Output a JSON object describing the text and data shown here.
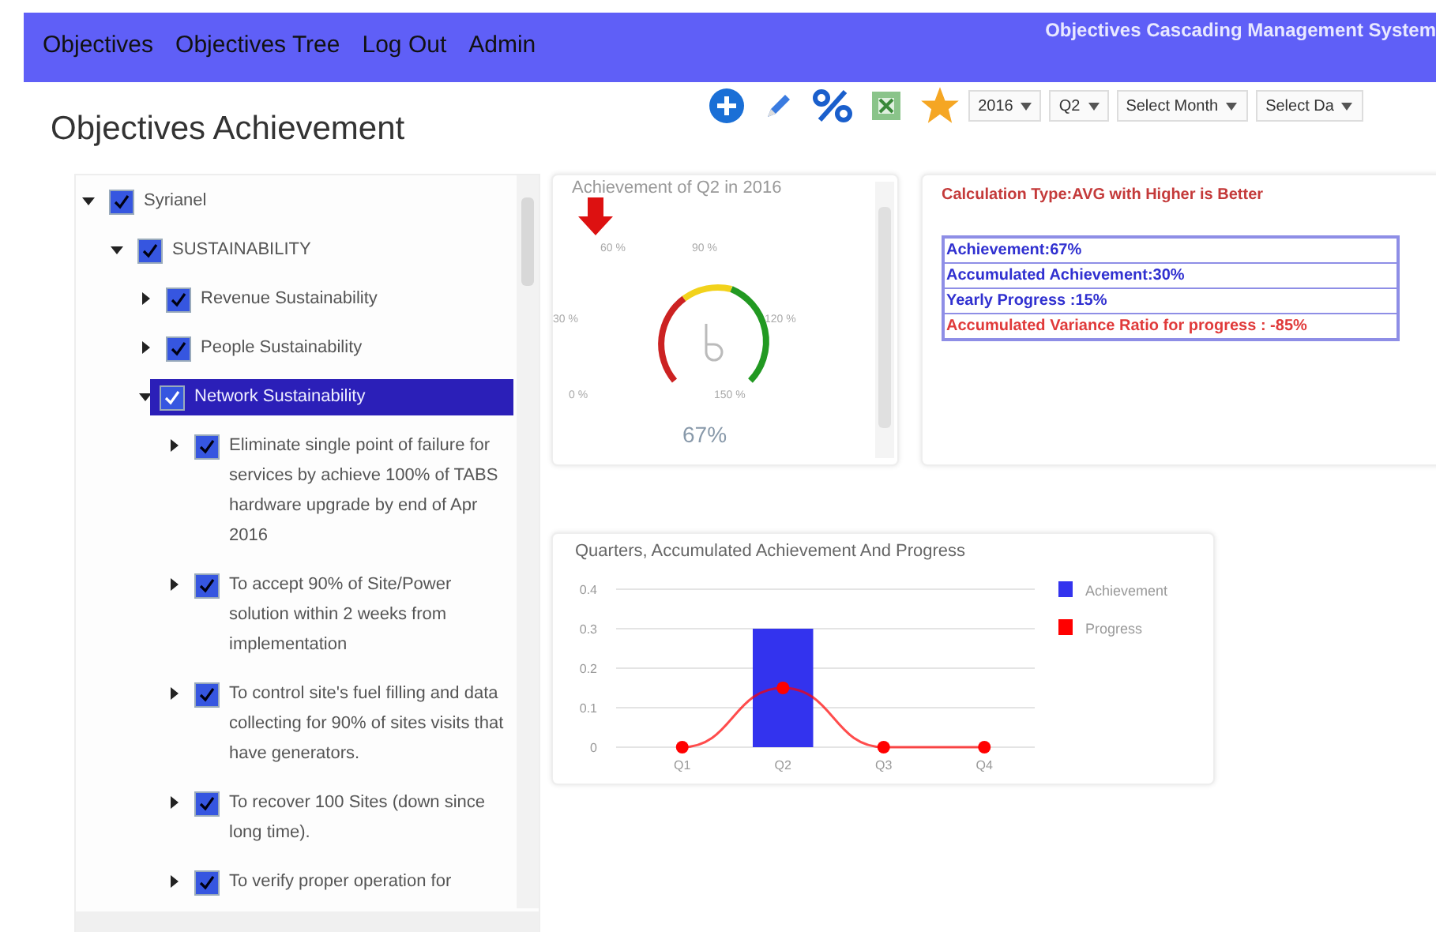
{
  "nav": {
    "links": [
      "Objectives",
      "Objectives Tree",
      "Log Out",
      "Admin"
    ],
    "system_title": "Objectives Cascading Management System"
  },
  "page_title": "Objectives Achievement",
  "toolbar": {
    "selects": [
      {
        "value": "2016"
      },
      {
        "value": "Q2"
      },
      {
        "value": "Select Month"
      },
      {
        "value": "Select Da"
      }
    ]
  },
  "tree": [
    {
      "label": "Syrianel",
      "checked": true,
      "expanded": true,
      "selected": false,
      "children": [
        {
          "label": "SUSTAINABILITY",
          "checked": true,
          "expanded": true,
          "selected": false,
          "children": [
            {
              "label": "Revenue Sustainability",
              "checked": true,
              "expanded": false,
              "selected": false
            },
            {
              "label": "People Sustainability",
              "checked": true,
              "expanded": false,
              "selected": false
            },
            {
              "label": "Network Sustainability",
              "checked": true,
              "expanded": true,
              "selected": true,
              "children": [
                {
                  "label": "Eliminate single point of failure for services by achieve 100% of TABS hardware upgrade by end of Apr 2016",
                  "checked": true,
                  "expanded": false,
                  "selected": false
                },
                {
                  "label": "To accept 90% of Site/Power solution within 2 weeks from implementation",
                  "checked": true,
                  "expanded": false,
                  "selected": false
                },
                {
                  "label": "To control site's fuel filling and data collecting for 90% of sites visits that have generators.",
                  "checked": true,
                  "expanded": false,
                  "selected": false
                },
                {
                  "label": "To recover 100 Sites (down since long time).",
                  "checked": true,
                  "expanded": false,
                  "selected": false
                },
                {
                  "label": "To verify proper operation for",
                  "checked": true,
                  "expanded": false,
                  "selected": false
                }
              ]
            }
          ]
        }
      ]
    }
  ],
  "gauge": {
    "title": "Achievement of Q2 in 2016",
    "scale": [
      "0 %",
      "30 %",
      "60 %",
      "90 %",
      "120 %",
      "150 %"
    ],
    "value": "67%"
  },
  "info": {
    "calculation": "Calculation Type:AVG with Higher is Better",
    "rows": [
      {
        "text": "Achievement:67%",
        "kind": "normal"
      },
      {
        "text": "Accumulated Achievement:30%",
        "kind": "normal"
      },
      {
        "text": "Yearly Progress :15%",
        "kind": "normal"
      },
      {
        "text": "Accumulated Variance Ratio for progress : -85%",
        "kind": "alert"
      }
    ]
  },
  "chart": {
    "chart_data": {
      "type": "bar",
      "title": "Quarters, Accumulated Achievement And Progress",
      "categories": [
        "Q1",
        "Q2",
        "Q3",
        "Q4"
      ],
      "series": [
        {
          "name": "Achievement",
          "color": "#3333ee",
          "type": "bar",
          "values": [
            0,
            0.3,
            0,
            0
          ]
        },
        {
          "name": "Progress",
          "color": "#ff0000",
          "type": "line",
          "marker": "circle",
          "values": [
            0,
            0.15,
            0,
            0
          ]
        }
      ],
      "ylim": [
        0,
        0.4
      ],
      "yticks": [
        0,
        0.1,
        0.2,
        0.3,
        0.4
      ],
      "grid": true,
      "legend": true
    }
  }
}
